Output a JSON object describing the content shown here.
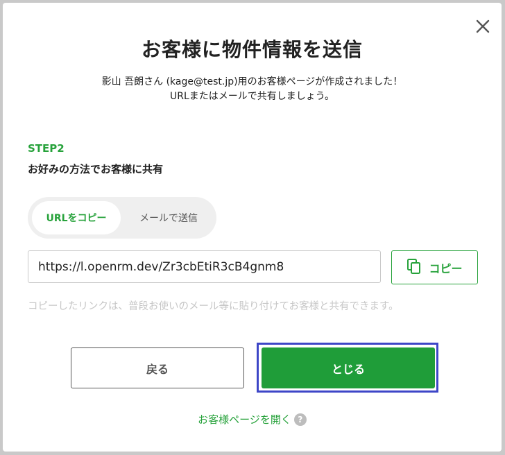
{
  "dialog": {
    "title": "お客様に物件情報を送信",
    "description_line1": "影山 吾朗さん (kage@test.jp)用のお客様ページが作成されました！",
    "description_line2": "URLまたはメールで共有しましょう。"
  },
  "step": {
    "label": "STEP2",
    "heading": "お好みの方法でお客様に共有"
  },
  "tabs": [
    {
      "label": "URLをコピー",
      "active": true
    },
    {
      "label": "メールで送信",
      "active": false
    }
  ],
  "url_field": {
    "value": "https://l.openrm.dev/Zr3cbEtiR3cB4gnm8"
  },
  "copy_button": {
    "label": "コピー"
  },
  "hint_text": "コピーしたリンクは、普段お使いのメール等に貼り付けてお客様と共有できます。",
  "buttons": {
    "back": "戻る",
    "close": "とじる"
  },
  "open_page_link": "お客様ページを開く",
  "help_icon_glyph": "?",
  "colors": {
    "accent": "#27a23b",
    "primary_button": "#1f9d39",
    "focus_outline": "#3d46c7"
  }
}
